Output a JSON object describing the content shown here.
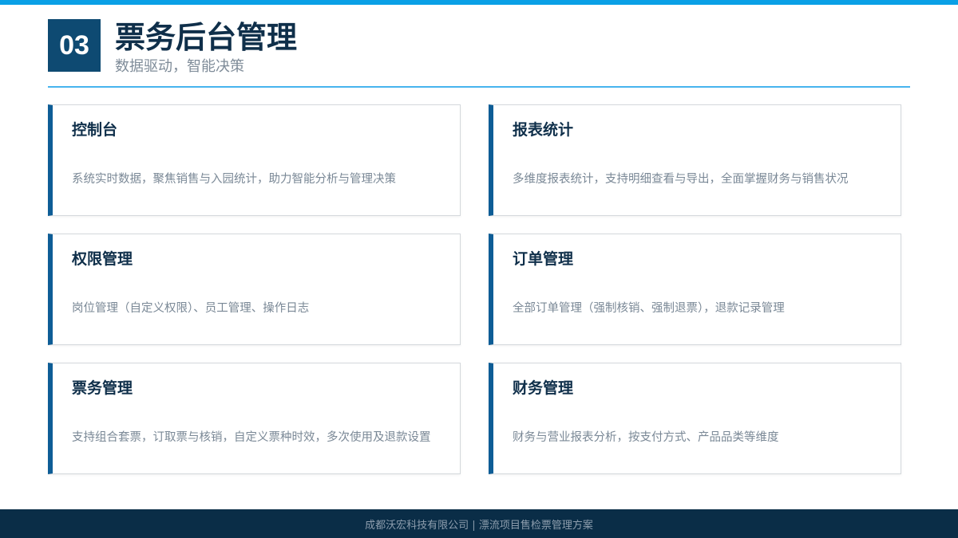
{
  "header": {
    "section_number": "03",
    "title": "票务后台管理",
    "subtitle": "数据驱动，智能决策"
  },
  "cards": [
    {
      "title": "控制台",
      "description": "系统实时数据，聚焦销售与入园统计，助力智能分析与管理决策"
    },
    {
      "title": "报表统计",
      "description": "多维度报表统计，支持明细查看与导出，全面掌握财务与销售状况"
    },
    {
      "title": "权限管理",
      "description": "岗位管理（自定义权限）、员工管理、操作日志"
    },
    {
      "title": "订单管理",
      "description": "全部订单管理（强制核销、强制退票），退款记录管理"
    },
    {
      "title": "票务管理",
      "description": "支持组合套票，订取票与核销，自定义票种时效，多次使用及退款设置"
    },
    {
      "title": "财务管理",
      "description": "财务与营业报表分析，按支付方式、产品品类等维度"
    }
  ],
  "footer": {
    "text": "成都沃宏科技有限公司 | 漂流项目售检票管理方案"
  },
  "colors": {
    "accent": "#0aa0e6",
    "brand_dark": "#0e4a72",
    "card_bar": "#0e5d96",
    "footer_bg": "#0a2d47"
  }
}
